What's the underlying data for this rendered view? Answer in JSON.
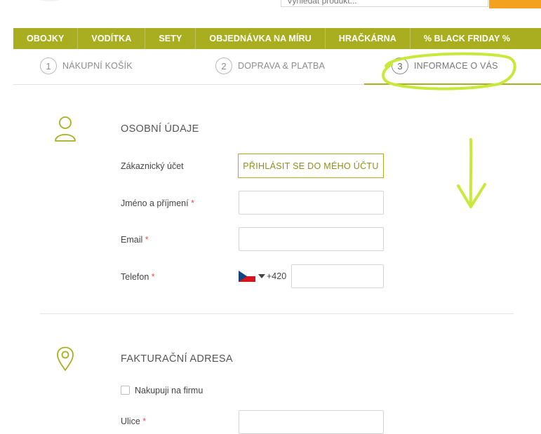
{
  "header": {
    "search": {
      "value": "",
      "placeholder": "Vyhledat produkt..."
    }
  },
  "nav": {
    "items": [
      {
        "label": "OBOJKY"
      },
      {
        "label": "VODÍTKA"
      },
      {
        "label": "SETY"
      },
      {
        "label": "OBJEDNÁVKA NA MÍRU"
      },
      {
        "label": "HRAČKÁRNA"
      },
      {
        "label": "% BLACK FRIDAY %"
      }
    ]
  },
  "steps": [
    {
      "number": "1",
      "label": "NÁKUPNÍ KOŠÍK",
      "active": false
    },
    {
      "number": "2",
      "label": "DOPRAVA & PLATBA",
      "active": false
    },
    {
      "number": "3",
      "label": "INFORMACE O VÁS",
      "active": true
    }
  ],
  "personal": {
    "title": "OSOBNÍ ÚDAJE",
    "account_label": "Zákaznický účet",
    "login_button": "PŘIHLÁSIT SE DO MÉHO ÚČTU",
    "name_label": "Jméno a příjmení",
    "email_label": "Email",
    "phone_label": "Telefon",
    "required_mark": "*",
    "phone_prefix": "+420",
    "name_value": "",
    "email_value": "",
    "phone_value": ""
  },
  "billing": {
    "title": "FAKTURAČNÍ ADRESA",
    "company_checkbox_label": "Nakupuji na firmu",
    "company_checked": false,
    "street_label": "Ulice",
    "street_value": ""
  },
  "colors": {
    "accent": "#a8ae20",
    "annotation": "#c8e83a",
    "search_button": "#f2a21d",
    "required": "#d9534f"
  },
  "icons": {
    "personal": "user-icon",
    "billing": "location-pin-icon",
    "phone_flag": "czech-flag-icon"
  }
}
